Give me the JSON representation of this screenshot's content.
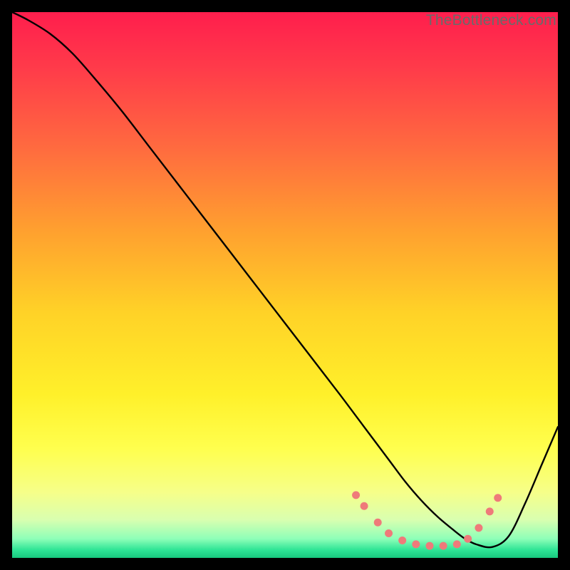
{
  "watermark": "TheBottleneck.com",
  "chart_data": {
    "type": "line",
    "title": "",
    "xlabel": "",
    "ylabel": "",
    "xlim": [
      0,
      100
    ],
    "ylim": [
      0,
      100
    ],
    "grid": false,
    "legend": false,
    "background_gradient": {
      "stops": [
        {
          "offset": 0.0,
          "color": "#ff1e4d"
        },
        {
          "offset": 0.1,
          "color": "#ff3a4a"
        },
        {
          "offset": 0.25,
          "color": "#ff6b3f"
        },
        {
          "offset": 0.4,
          "color": "#ffa02f"
        },
        {
          "offset": 0.55,
          "color": "#ffd227"
        },
        {
          "offset": 0.7,
          "color": "#fff02a"
        },
        {
          "offset": 0.8,
          "color": "#ffff4e"
        },
        {
          "offset": 0.88,
          "color": "#f6ff89"
        },
        {
          "offset": 0.93,
          "color": "#d9ffb0"
        },
        {
          "offset": 0.965,
          "color": "#8effb8"
        },
        {
          "offset": 0.985,
          "color": "#2fe596"
        },
        {
          "offset": 1.0,
          "color": "#18c77e"
        }
      ]
    },
    "series": [
      {
        "name": "curve",
        "color": "#000000",
        "x": [
          0,
          3,
          7,
          11,
          15,
          20,
          25,
          30,
          35,
          40,
          45,
          50,
          55,
          60,
          63,
          66,
          69,
          72,
          75,
          78,
          81,
          83,
          85,
          88,
          91,
          94,
          97,
          100
        ],
        "y": [
          100,
          98.5,
          96,
          92.5,
          88,
          82,
          75.5,
          69,
          62.5,
          56,
          49.5,
          43,
          36.5,
          30,
          26,
          22,
          18,
          14,
          10.5,
          7.5,
          5,
          3.5,
          2.5,
          2,
          4,
          10,
          17,
          24
        ]
      }
    ],
    "markers": {
      "name": "dotted-segment",
      "color": "#ef7a7a",
      "radius": 5.5,
      "points": [
        {
          "x": 63,
          "y": 11.5
        },
        {
          "x": 64.5,
          "y": 9.5
        },
        {
          "x": 67,
          "y": 6.5
        },
        {
          "x": 69,
          "y": 4.5
        },
        {
          "x": 71.5,
          "y": 3.2
        },
        {
          "x": 74,
          "y": 2.5
        },
        {
          "x": 76.5,
          "y": 2.2
        },
        {
          "x": 79,
          "y": 2.2
        },
        {
          "x": 81.5,
          "y": 2.5
        },
        {
          "x": 83.5,
          "y": 3.5
        },
        {
          "x": 85.5,
          "y": 5.5
        },
        {
          "x": 87.5,
          "y": 8.5
        },
        {
          "x": 89,
          "y": 11
        }
      ]
    }
  }
}
